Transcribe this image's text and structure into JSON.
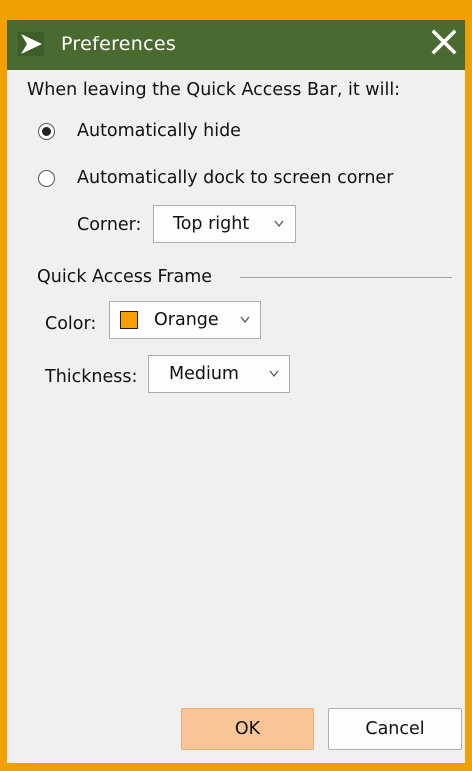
{
  "window": {
    "title": "Preferences",
    "frame_color": "#f0a000",
    "titlebar_color": "#4a6b30",
    "title_icon": "play-chevron-icon",
    "close_icon": "close-x-icon"
  },
  "behavior": {
    "prompt": "When leaving the Quick Access Bar, it will:",
    "options": [
      {
        "label": "Automatically hide",
        "selected": true
      },
      {
        "label": "Automatically dock to screen corner",
        "selected": false
      }
    ],
    "corner": {
      "label": "Corner:",
      "value": "Top right"
    }
  },
  "frame": {
    "group_label": "Quick Access Frame",
    "color": {
      "label": "Color:",
      "value": "Orange",
      "swatch": "#f6a000"
    },
    "thickness": {
      "label": "Thickness:",
      "value": "Medium"
    }
  },
  "buttons": {
    "ok": "OK",
    "cancel": "Cancel",
    "ok_color": "#f8c696"
  }
}
